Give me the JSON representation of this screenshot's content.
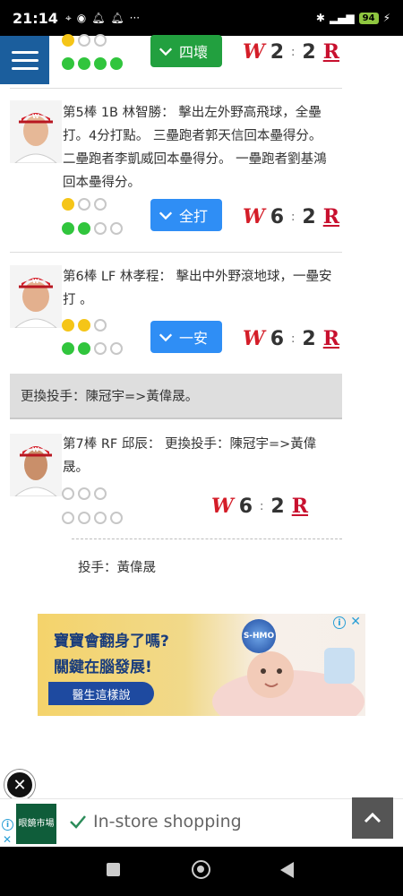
{
  "status_bar": {
    "time": "21:14",
    "battery": "94"
  },
  "entries": [
    {
      "bases_top": [
        "y",
        "e",
        "e"
      ],
      "bases_bottom": [
        "g",
        "g",
        "g",
        "g"
      ],
      "result": "四壞",
      "result_color": "green",
      "score_away": "2",
      "score_home": "2"
    },
    {
      "desc": "第5棒 1B 林智勝： 擊出左外野高飛球，全壘打。4分打點。 三壘跑者郭天信回本壘得分。 二壘跑者李凱威回本壘得分。 一壘跑者劉基鴻回本壘得分。",
      "bases_top": [
        "y",
        "e",
        "e"
      ],
      "bases_bottom": [
        "g",
        "g",
        "e",
        "e"
      ],
      "result": "全打",
      "result_color": "blue",
      "score_away": "6",
      "score_home": "2"
    },
    {
      "desc": "第6棒 LF 林孝程： 擊出中外野滾地球，一壘安打 。",
      "bases_top": [
        "y",
        "y",
        "e"
      ],
      "bases_bottom": [
        "g",
        "g",
        "e",
        "e"
      ],
      "result": "一安",
      "result_color": "blue",
      "score_away": "6",
      "score_home": "2"
    },
    {
      "desc": "第7棒 RF 邱辰： 更換投手：陳冠宇=>黃偉晟。",
      "bases_top": [
        "e",
        "e",
        "e"
      ],
      "bases_bottom": [
        "e",
        "e",
        "e",
        "e"
      ],
      "score_away": "6",
      "score_home": "2"
    }
  ],
  "pitcher_change": "更換投手：陳冠宇=>黃偉晟。",
  "pitcher_line": "投手：黃偉晟",
  "score_colon": ":",
  "logo_w": "W",
  "logo_r": "R",
  "ad_banner": {
    "line1": "寶寶會翻身了嗎?",
    "line2": "關鍵在腦發展!",
    "cta": "醫生這樣說",
    "badge": "S-HMO"
  },
  "bottom_ad": {
    "brand_line1": "眼鏡市場",
    "text": "In-store shopping"
  },
  "colors": {
    "menu_bg": "#1b5e9d",
    "green_button": "#22a03f",
    "blue_button": "#2f8ef5",
    "brand_red": "#d41d28"
  }
}
